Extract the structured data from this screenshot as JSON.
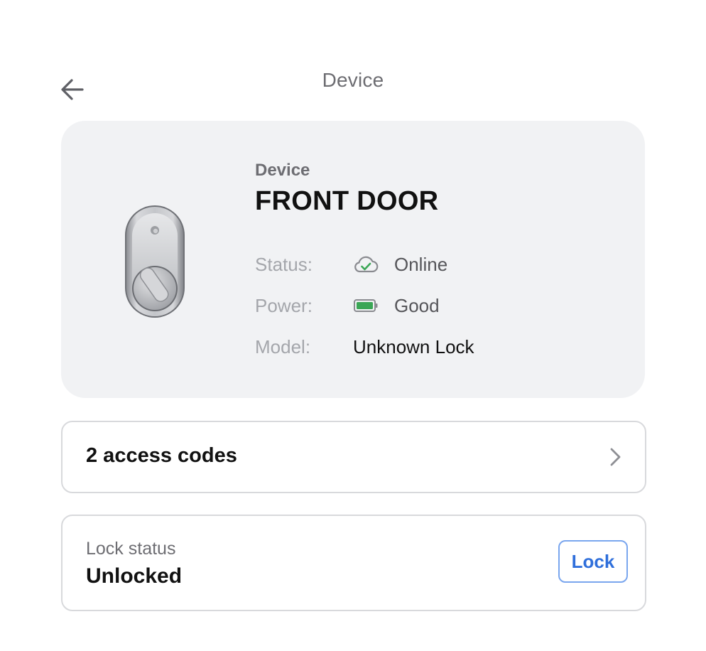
{
  "header": {
    "title": "Device",
    "back_icon": "arrow-left-icon"
  },
  "device": {
    "label": "Device",
    "name": "FRONT DOOR",
    "image": "smart-lock-icon",
    "status": {
      "key": "Status:",
      "icon": "cloud-check-icon",
      "value": "Online",
      "color": "#3aa655"
    },
    "power": {
      "key": "Power:",
      "icon": "battery-icon",
      "value": "Good",
      "color": "#3aa655"
    },
    "model": {
      "key": "Model:",
      "value": "Unknown Lock"
    }
  },
  "access_codes": {
    "label": "2 access codes",
    "icon": "chevron-right-icon"
  },
  "lock_status": {
    "label": "Lock status",
    "value": "Unlocked",
    "button_label": "Lock",
    "accent": "#2f6fdb"
  }
}
